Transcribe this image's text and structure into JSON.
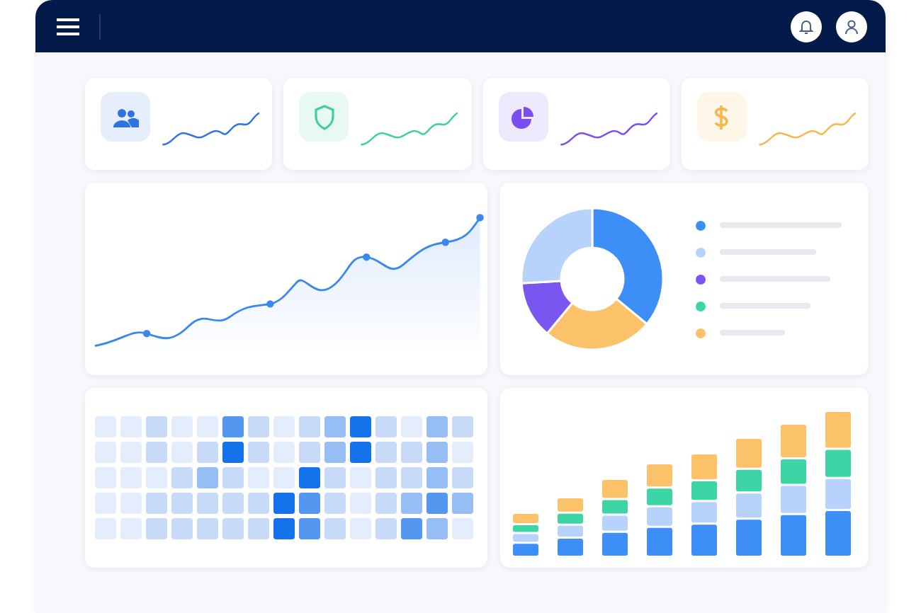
{
  "header": {
    "buttons": [
      {
        "kind": "menu"
      },
      {
        "kind": "bell"
      },
      {
        "kind": "user"
      }
    ]
  },
  "stat_cards": [
    {
      "kind": "users",
      "color": "#2f72e4"
    },
    {
      "kind": "shield",
      "color": "#3fcf9c"
    },
    {
      "kind": "pie",
      "color": "#7a4ef0"
    },
    {
      "kind": "dollar",
      "color": "#f5b74e"
    }
  ],
  "donut_legend": [
    {
      "color": "#3d8ef7"
    },
    {
      "color": "#b8d3fb"
    },
    {
      "color": "#7b55f0"
    },
    {
      "color": "#3ed5a6"
    },
    {
      "color": "#fcc26a"
    }
  ]
}
